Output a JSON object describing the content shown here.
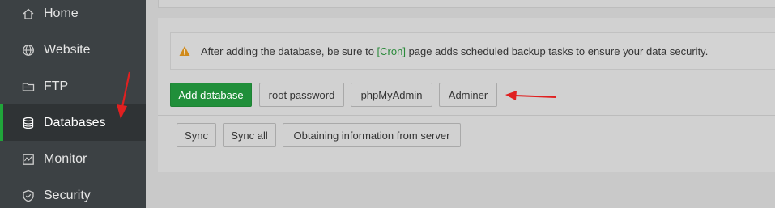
{
  "sidebar": {
    "items": [
      {
        "label": "Home",
        "icon": "home-icon"
      },
      {
        "label": "Website",
        "icon": "globe-icon"
      },
      {
        "label": "FTP",
        "icon": "ftp-icon"
      },
      {
        "label": "Databases",
        "icon": "database-icon",
        "active": true
      },
      {
        "label": "Monitor",
        "icon": "monitor-icon"
      },
      {
        "label": "Security",
        "icon": "shield-icon"
      }
    ]
  },
  "notice": {
    "before": "After adding the database, be sure to ",
    "link": "[Cron]",
    "after": " page adds scheduled backup tasks to ensure your data security."
  },
  "toolbar": {
    "add_database": "Add database",
    "root_password": "root password",
    "phpmyadmin": "phpMyAdmin",
    "adminer": "Adminer"
  },
  "sync_toolbar": {
    "sync": "Sync",
    "sync_all": "Sync all",
    "obtain_info": "Obtaining information from server"
  },
  "colors": {
    "accent": "#20a53a",
    "sidebar_bg": "#3c4144",
    "annotation_arrow": "#e02020"
  }
}
